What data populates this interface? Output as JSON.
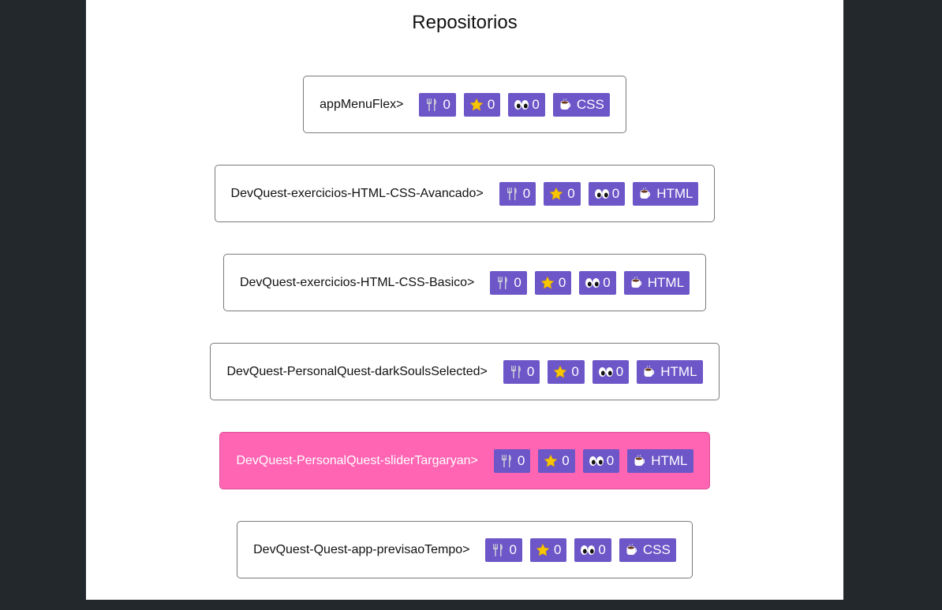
{
  "page": {
    "title": "Repositorios"
  },
  "icons": {
    "fork": "fork-and-knife-icon",
    "star": "star-icon",
    "watch": "eyes-icon",
    "language": "coffee-cup-icon"
  },
  "colors": {
    "badge": "#6c56c8",
    "active_card": "#ff65b3",
    "star": "#f7c600"
  },
  "repos": [
    {
      "name": "appMenuFlex>",
      "forks": "0",
      "stars": "0",
      "watchers": "0",
      "language": "CSS",
      "active": false
    },
    {
      "name": "DevQuest-exercicios-HTML-CSS-Avancado>",
      "forks": "0",
      "stars": "0",
      "watchers": "0",
      "language": "HTML",
      "active": false
    },
    {
      "name": "DevQuest-exercicios-HTML-CSS-Basico>",
      "forks": "0",
      "stars": "0",
      "watchers": "0",
      "language": "HTML",
      "active": false
    },
    {
      "name": "DevQuest-PersonalQuest-darkSoulsSelected>",
      "forks": "0",
      "stars": "0",
      "watchers": "0",
      "language": "HTML",
      "active": false
    },
    {
      "name": "DevQuest-PersonalQuest-sliderTargaryan>",
      "forks": "0",
      "stars": "0",
      "watchers": "0",
      "language": "HTML",
      "active": true
    },
    {
      "name": "DevQuest-Quest-app-previsaoTempo>",
      "forks": "0",
      "stars": "0",
      "watchers": "0",
      "language": "CSS",
      "active": false
    }
  ]
}
